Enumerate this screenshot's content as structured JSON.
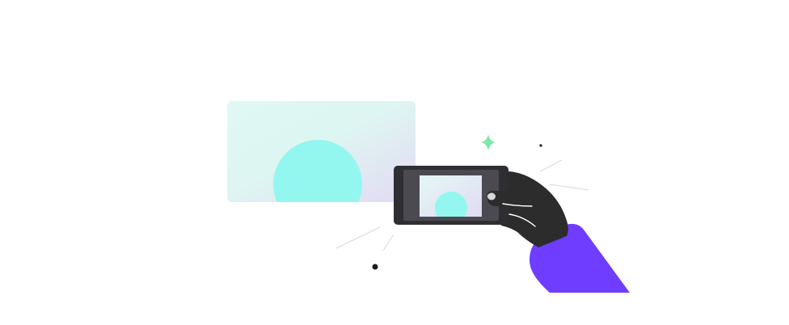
{
  "illustration": {
    "elements": [
      {
        "name": "scene-card",
        "icon": "gradient-card"
      },
      {
        "name": "photo-phone",
        "icon": "phone-camera-icon"
      },
      {
        "name": "hand",
        "icon": "hand-icon"
      },
      {
        "name": "sleeve",
        "icon": "sleeve-shape"
      },
      {
        "name": "sparkle",
        "icon": "sparkle-icon"
      }
    ],
    "colors": {
      "background": "#ffffff",
      "card_gradient_start": "#dff8f3",
      "card_gradient_end": "#e2dbf3",
      "circle": "#93f7f0",
      "phone_body": "#2f2f33",
      "phone_bezel": "#4a4a50",
      "hand": "#2c2c2c",
      "sleeve": "#6e3dff",
      "sparkle": "#7ce8a7",
      "dots": "#1c1c1c",
      "lines": "#d9d9d9"
    }
  }
}
